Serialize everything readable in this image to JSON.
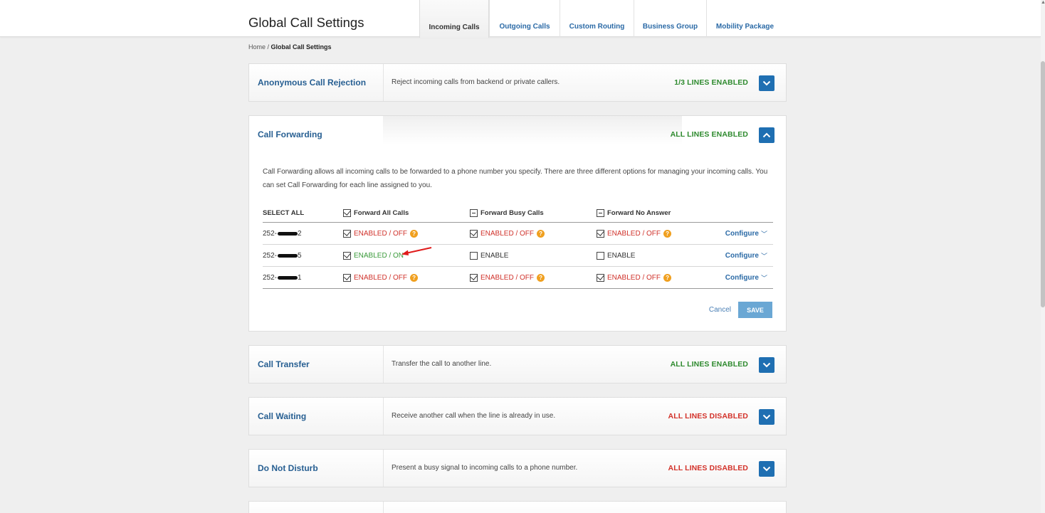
{
  "header": {
    "title": "Global Call Settings",
    "tabs": [
      {
        "label": "Incoming Calls"
      },
      {
        "label": "Outgoing Calls"
      },
      {
        "label": "Custom Routing"
      },
      {
        "label": "Business Group"
      },
      {
        "label": "Mobility Package"
      }
    ]
  },
  "breadcrumb": {
    "home": "Home",
    "separator": " / ",
    "current": "Global Call Settings"
  },
  "panels": {
    "anonymous": {
      "title": "Anonymous Call Rejection",
      "desc": "Reject incoming calls from backend or private callers.",
      "status": "1/3 LINES ENABLED"
    },
    "forwarding": {
      "title": "Call Forwarding",
      "status": "ALL LINES ENABLED",
      "intro": "Call Forwarding allows all incoming calls to be forwarded to a phone number you specify. There are three different options for managing your incoming calls. You can set Call Forwarding for each line assigned to you.",
      "columns": [
        "SELECT ALL",
        "Forward All Calls",
        "Forward Busy Calls",
        "Forward No Answer"
      ],
      "rows": [
        {
          "prefix": "252-",
          "suffix": "2",
          "all": "ENABLED / OFF",
          "busy": "ENABLED / OFF",
          "noanswer": "ENABLED / OFF",
          "configure": "Configure"
        },
        {
          "prefix": "252-",
          "suffix": "5",
          "all": "ENABLED / ON",
          "busy": "ENABLE",
          "noanswer": "ENABLE",
          "configure": "Configure"
        },
        {
          "prefix": "252-",
          "suffix": "1",
          "all": "ENABLED / OFF",
          "busy": "ENABLED / OFF",
          "noanswer": "ENABLED / OFF",
          "configure": "Configure"
        }
      ],
      "cancel": "Cancel",
      "save": "SAVE"
    },
    "transfer": {
      "title": "Call Transfer",
      "desc": "Transfer the call to another line.",
      "status": "ALL LINES ENABLED"
    },
    "waiting": {
      "title": "Call Waiting",
      "desc": "Receive another call when the line is already in use.",
      "status": "ALL LINES DISABLED"
    },
    "dnd": {
      "title": "Do Not Disturb",
      "desc": "Present a busy signal to incoming calls to a phone number.",
      "status": "ALL LINES DISABLED"
    }
  },
  "icons": {
    "help": "?",
    "chevron": "﹀"
  },
  "colors": {
    "accent": "#1f6fb2",
    "enabled": "#2e8a2e",
    "disabled": "#d3322a",
    "warning": "#f0a020"
  }
}
